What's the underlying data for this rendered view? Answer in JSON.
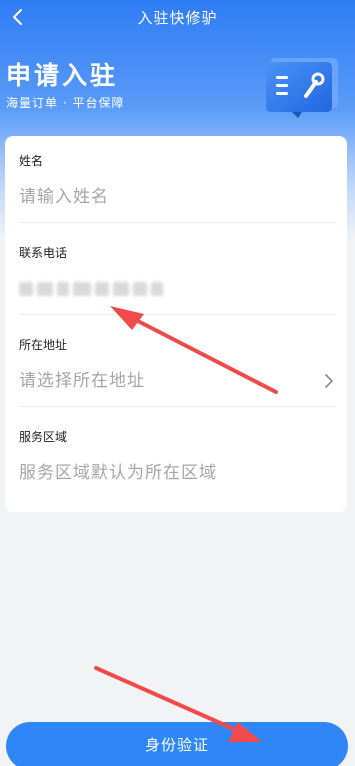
{
  "nav": {
    "back_icon": "chevron-left-icon",
    "title": "入驻快修驴"
  },
  "hero": {
    "headline": "申请入驻",
    "subline": "海量订单 · 平台保障",
    "illustration_icon": "wrench-book-icon"
  },
  "form": {
    "fields": [
      {
        "label": "姓名",
        "placeholder": "请输入姓名"
      },
      {
        "label": "联系电话",
        "value": ""
      },
      {
        "label": "所在地址",
        "placeholder": "请选择所在地址"
      },
      {
        "label": "服务区域",
        "placeholder": "服务区域默认为所在区域"
      }
    ]
  },
  "submit": {
    "label": "身份验证"
  },
  "colors": {
    "primary": "#2f86f6",
    "annotation": "#f04a4a"
  }
}
